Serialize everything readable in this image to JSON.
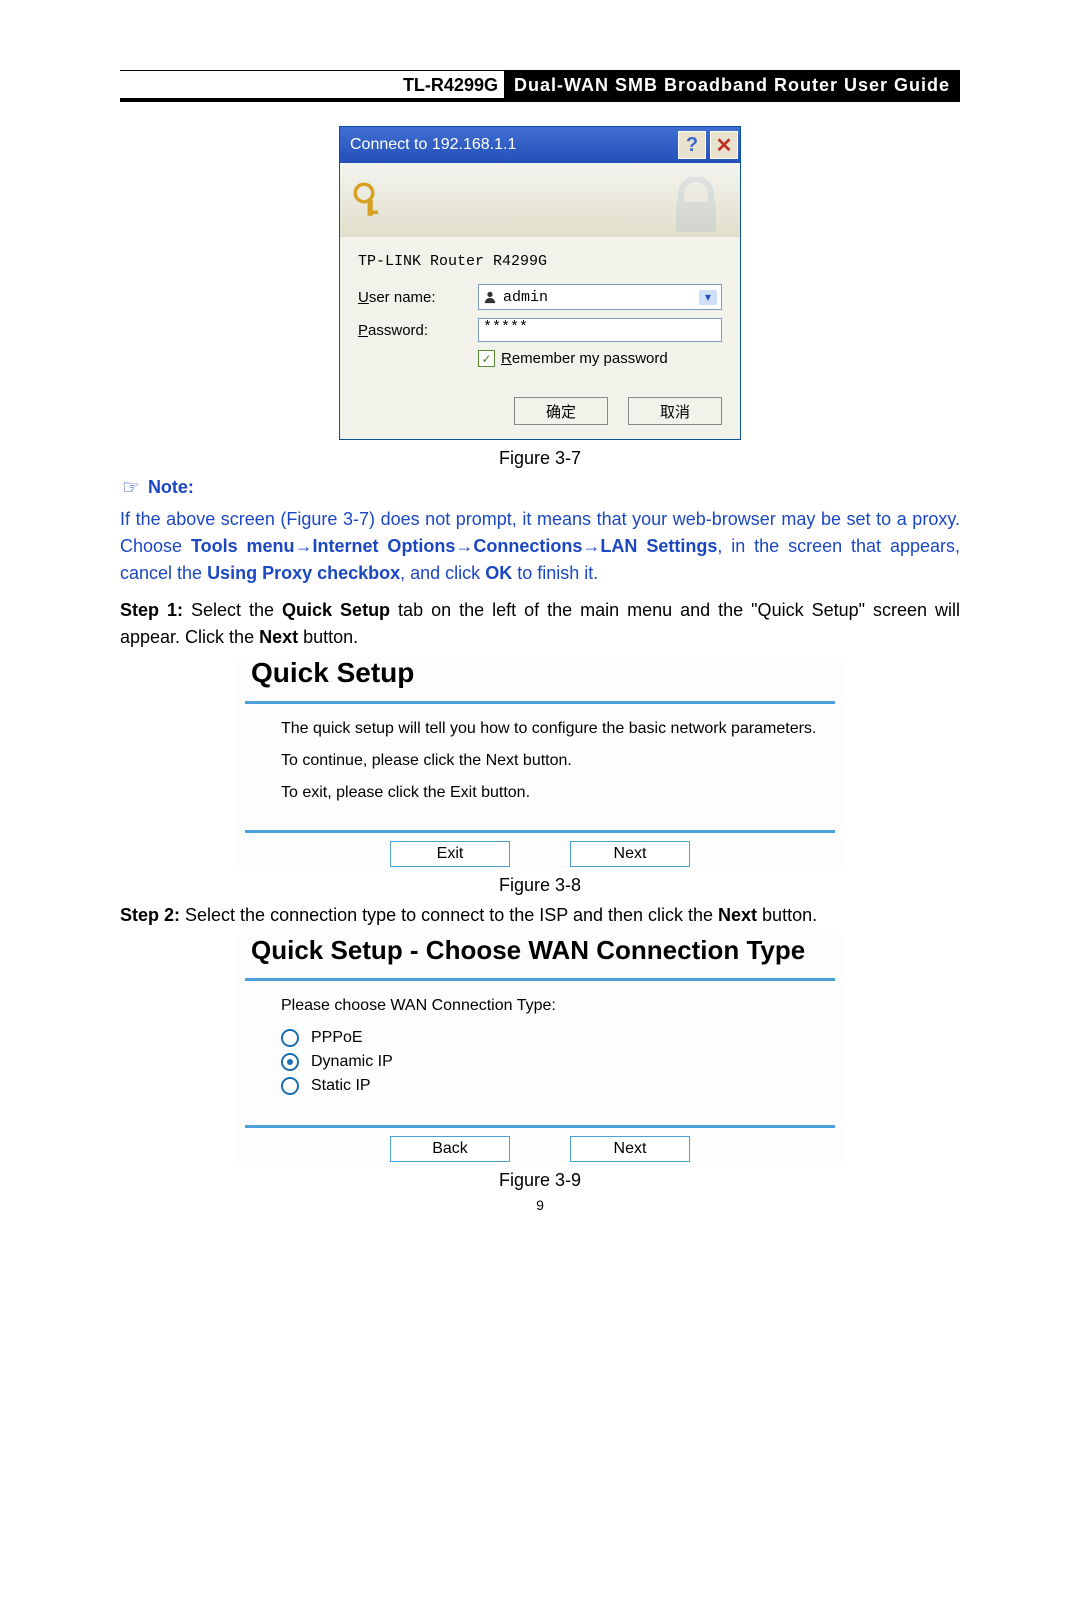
{
  "header": {
    "model": "TL-R4299G",
    "title": "Dual-WAN SMB Broadband Router User Guide"
  },
  "loginDialog": {
    "title": "Connect to 192.168.1.1",
    "routerName": "TP-LINK Router R4299G",
    "userLabel": "User name:",
    "userValue": "admin",
    "passLabel": "Password:",
    "passValue": "*****",
    "rememberLabel": "Remember my password",
    "ok": "确定",
    "cancel": "取消"
  },
  "fig37": "Figure 3-7",
  "note": {
    "label": "Note:",
    "p1a": "If the above screen (Figure 3-7) does not prompt, it means that your web-browser may be set to a proxy. Choose ",
    "p1b": "Tools menu→Internet Options→Connections→LAN Settings",
    "p1c": ", in the screen that appears, cancel the ",
    "p1d": "Using Proxy checkbox",
    "p1e": ", and click ",
    "p1f": "OK",
    "p1g": " to finish it."
  },
  "step1": {
    "label": "Step 1:",
    "a": " Select the ",
    "b": "Quick Setup",
    "c": " tab on the left of the main menu and the \"Quick Setup\" screen will appear. Click the ",
    "d": "Next",
    "e": " button."
  },
  "qs1": {
    "title": "Quick Setup",
    "line1": "The quick setup will tell you how to configure the basic network parameters.",
    "line2a": "To continue, please click the ",
    "line2b": "Next",
    "line2c": " button.",
    "line3a": "To exit, please click the ",
    "line3b": "Exit",
    "line3c": " button.",
    "exit": "Exit",
    "next": "Next"
  },
  "fig38": "Figure 3-8",
  "step2": {
    "label": "Step 2:",
    "a": " Select the connection type to connect to the ISP and then click the ",
    "b": "Next",
    "c": " button."
  },
  "qs2": {
    "title": "Quick Setup - Choose WAN Connection Type",
    "prompt": "Please choose WAN Connection Type:",
    "opt1": "PPPoE",
    "opt2": "Dynamic IP",
    "opt3": "Static IP",
    "back": "Back",
    "next": "Next"
  },
  "fig39": "Figure 3-9",
  "pageNumber": "9"
}
